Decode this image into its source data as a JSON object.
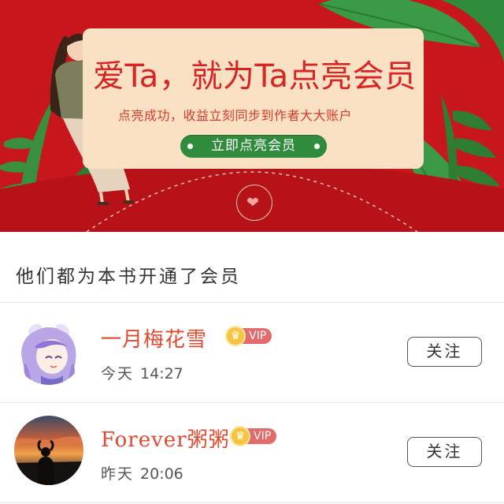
{
  "banner": {
    "headline": "爱Ta，就为Ta点亮会员",
    "subline": "点亮成功，收益立刻同步到作者大大账户",
    "cta_label": "立即点亮会员",
    "seal_icon": "heart-icon",
    "colors": {
      "background": "#c8161d",
      "card": "#fbe1c4",
      "headline": "#d92424",
      "cta": "#2f8c3c"
    }
  },
  "section": {
    "title": "他们都为本书开通了会员"
  },
  "members": [
    {
      "name": "一月梅花雪",
      "badge": "VIP",
      "day": "今天",
      "time": "14:27",
      "follow_label": "关注"
    },
    {
      "name": "Forever粥粥",
      "badge": "VIP",
      "day": "昨天",
      "time": "20:06",
      "follow_label": "关注"
    }
  ],
  "colors": {
    "username": "#e2492f",
    "vip_tag": "#e36b6b",
    "crown": "#f5c542"
  }
}
